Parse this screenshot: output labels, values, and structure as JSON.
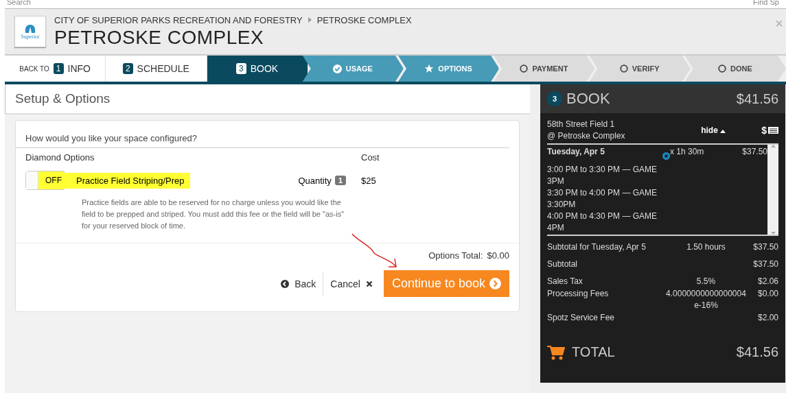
{
  "background": {
    "search": "Search",
    "find": "Find Sp"
  },
  "header": {
    "logo_text": "Superior",
    "breadcrumb": [
      "CITY OF SUPERIOR PARKS RECREATION AND FORESTRY",
      "PETROSKE COMPLEX"
    ],
    "title": "PETROSKE COMPLEX",
    "close": "×"
  },
  "steps": [
    {
      "kind": "link",
      "prefix": "BACK TO",
      "number": "1",
      "label": "INFO",
      "selected": false
    },
    {
      "kind": "link",
      "number": "2",
      "label": "SCHEDULE",
      "selected": false
    },
    {
      "kind": "link",
      "number": "3",
      "label": "BOOK",
      "selected": true
    },
    {
      "kind": "done",
      "label": "USAGE",
      "selected": false
    },
    {
      "kind": "active",
      "label": "OPTIONS",
      "selected": false
    },
    {
      "kind": "pending",
      "label": "PAYMENT",
      "selected": false
    },
    {
      "kind": "pending",
      "label": "VERIFY",
      "selected": false
    },
    {
      "kind": "pending",
      "label": "DONE",
      "selected": false
    }
  ],
  "section_title": "Setup & Options",
  "options": {
    "question": "How would you like your space configured?",
    "group": "Diamond Options",
    "cost_heading": "Cost",
    "items": [
      {
        "toggle": "OFF",
        "on": false,
        "name": "Practice Field Striping/Prep",
        "quantity_label": "Quantity",
        "quantity": "1",
        "cost": "$25",
        "description": "Practice fields are able to be reserved for no charge unless you would like the field to be prepped and striped. You must add this fee or the field will be \"as-is\" for your reserved block of time."
      }
    ],
    "total_label": "Options Total:",
    "total": "$0.00"
  },
  "actions": {
    "back": "Back",
    "cancel": "Cancel",
    "continue": "Continue to book"
  },
  "summary": {
    "step": "3",
    "title": "BOOK",
    "amount": "$41.56",
    "facility": [
      "58th Street Field 1",
      "@ Petroske Complex"
    ],
    "hide": "hide",
    "currency_symbol": "$",
    "day": {
      "date": "Tuesday, Apr 5",
      "duration": "x 1h 30m",
      "price": "$37.50",
      "slots": [
        "3:00 PM to 3:30 PM — GAME 3PM",
        "3:30 PM to 4:00 PM — GAME 3:30PM",
        "4:00 PM to 4:30 PM — GAME 4PM"
      ]
    },
    "line_groups": [
      [
        {
          "label": "Subtotal for Tuesday, Apr 5",
          "detail": "1.50 hours",
          "amount": "$37.50"
        }
      ],
      [
        {
          "label": "Subtotal",
          "amount": "$37.50"
        }
      ],
      [
        {
          "label": "Sales Tax",
          "detail": "5.5%",
          "amount": "$2.06"
        },
        {
          "label": "Processing Fees",
          "detail": "4.0000000000000004e-16%",
          "amount": "$0.00"
        },
        {
          "label": "Spotz Service Fee",
          "amount": "$2.00"
        }
      ]
    ],
    "total_label": "TOTAL",
    "total": "$41.56"
  }
}
